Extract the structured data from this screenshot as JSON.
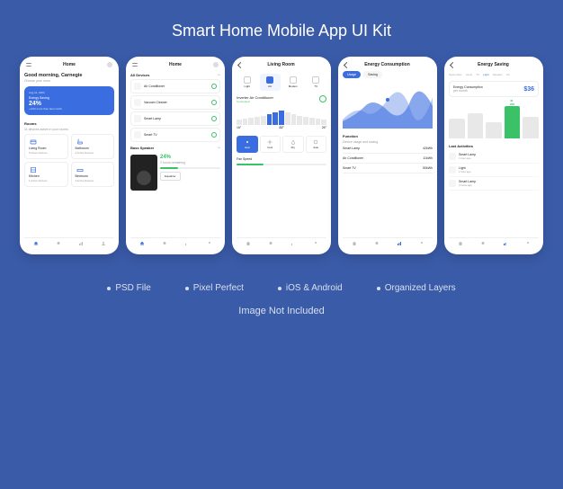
{
  "title": "Smart Home Mobile App UI Kit",
  "features": [
    "PSD File",
    "Pixel Perfect",
    "iOS & Android",
    "Organized Layers"
  ],
  "not_included": "Image Not Included",
  "screen1": {
    "header": "Home",
    "greeting": "Good morning, Carnegie",
    "greeting_sub": "Choose your room",
    "card_date": "Aug 11, 2022",
    "card_label": "Energy Saving",
    "card_pct": "24%",
    "card_note": "+12% more than last month",
    "rooms_h": "Rooms",
    "rooms_sub": "11 devices active in your rooms",
    "rooms": [
      {
        "name": "Living Room",
        "sub": "5 Active Devices"
      },
      {
        "name": "Bathroom",
        "sub": "2 Active Devices"
      },
      {
        "name": "Kitchen",
        "sub": "1 Active Devices"
      },
      {
        "name": "Bedroom",
        "sub": "3 Active Devices"
      }
    ]
  },
  "screen2": {
    "header": "Home",
    "section": "All Devices",
    "devices": [
      "Air Conditioner",
      "Vacuum Cleaner",
      "Smart Lamp",
      "Smart TV"
    ],
    "featured_h": "Bass Speaker",
    "featured_pct": "24%",
    "featured_sub": "2 hours remaining",
    "eq_btn": "Equalizer"
  },
  "screen3": {
    "header": "Living Room",
    "cats": [
      "Light",
      "AC",
      "Modem",
      "TV"
    ],
    "cat_active": 1,
    "ac_title": "Inverter Air Conditioner",
    "ac_status": "Connected",
    "temps": [
      "16°",
      "21°",
      "26°"
    ],
    "modes": [
      "Heat",
      "Cool",
      "Dry",
      "Auto"
    ],
    "mode_active": 0,
    "fan_label": "Fan Speed"
  },
  "screen4": {
    "header": "Energy Consumption",
    "chips": [
      "Usage",
      "Saving"
    ],
    "chip_active": 0,
    "func_h": "Function",
    "func_sub": "Device usage and saving",
    "funcs": [
      {
        "name": "Smart Lamp",
        "val": "42kWh"
      },
      {
        "name": "Air Conditioner",
        "val": "11kWh"
      },
      {
        "name": "Smart TV",
        "val": "50kWh"
      }
    ],
    "chart_data": {
      "type": "area",
      "series": [
        {
          "name": "Usage",
          "values": [
            20,
            35,
            28,
            50,
            38,
            60,
            45
          ]
        },
        {
          "name": "Saving",
          "values": [
            15,
            25,
            40,
            30,
            45,
            35,
            55
          ]
        }
      ]
    }
  },
  "screen5": {
    "header": "Energy Saving",
    "tabs": [
      "September",
      "Lamp",
      "TV",
      "Light",
      "Speaker",
      "AC"
    ],
    "tab_active": 3,
    "cost_label": "Energy Consumption",
    "cost_val": "$36",
    "cost_sub": "per month",
    "bar_hl": "46",
    "bar_unit": "kWh",
    "act_h": "Last Activities",
    "acts": [
      {
        "name": "Smart Lamp",
        "sub": "1 hour ago"
      },
      {
        "name": "Light",
        "sub": "1 hour ago"
      },
      {
        "name": "Smart Lamp",
        "sub": "2 hours ago"
      }
    ],
    "chart_data": {
      "type": "bar",
      "values": [
        30,
        38,
        25,
        46,
        32
      ],
      "highlight_index": 3
    }
  }
}
